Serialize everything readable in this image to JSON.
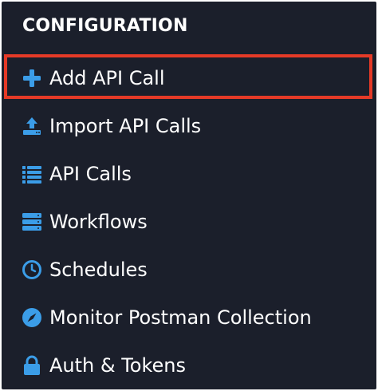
{
  "window": {
    "background": "#1b1f2b"
  },
  "section": {
    "title": "CONFIGURATION"
  },
  "menu": {
    "accent_color": "#3b9de8",
    "highlight_color": "#e53a27",
    "highlighted_item": "Add API Call",
    "items": [
      {
        "label": "Add API Call",
        "icon": "plus-icon"
      },
      {
        "label": "Import API Calls",
        "icon": "upload-icon"
      },
      {
        "label": "API Calls",
        "icon": "list-icon"
      },
      {
        "label": "Workflows",
        "icon": "stack-icon"
      },
      {
        "label": "Schedules",
        "icon": "clock-icon"
      },
      {
        "label": "Monitor Postman Collection",
        "icon": "compass-icon"
      },
      {
        "label": "Auth & Tokens",
        "icon": "lock-icon"
      }
    ]
  }
}
